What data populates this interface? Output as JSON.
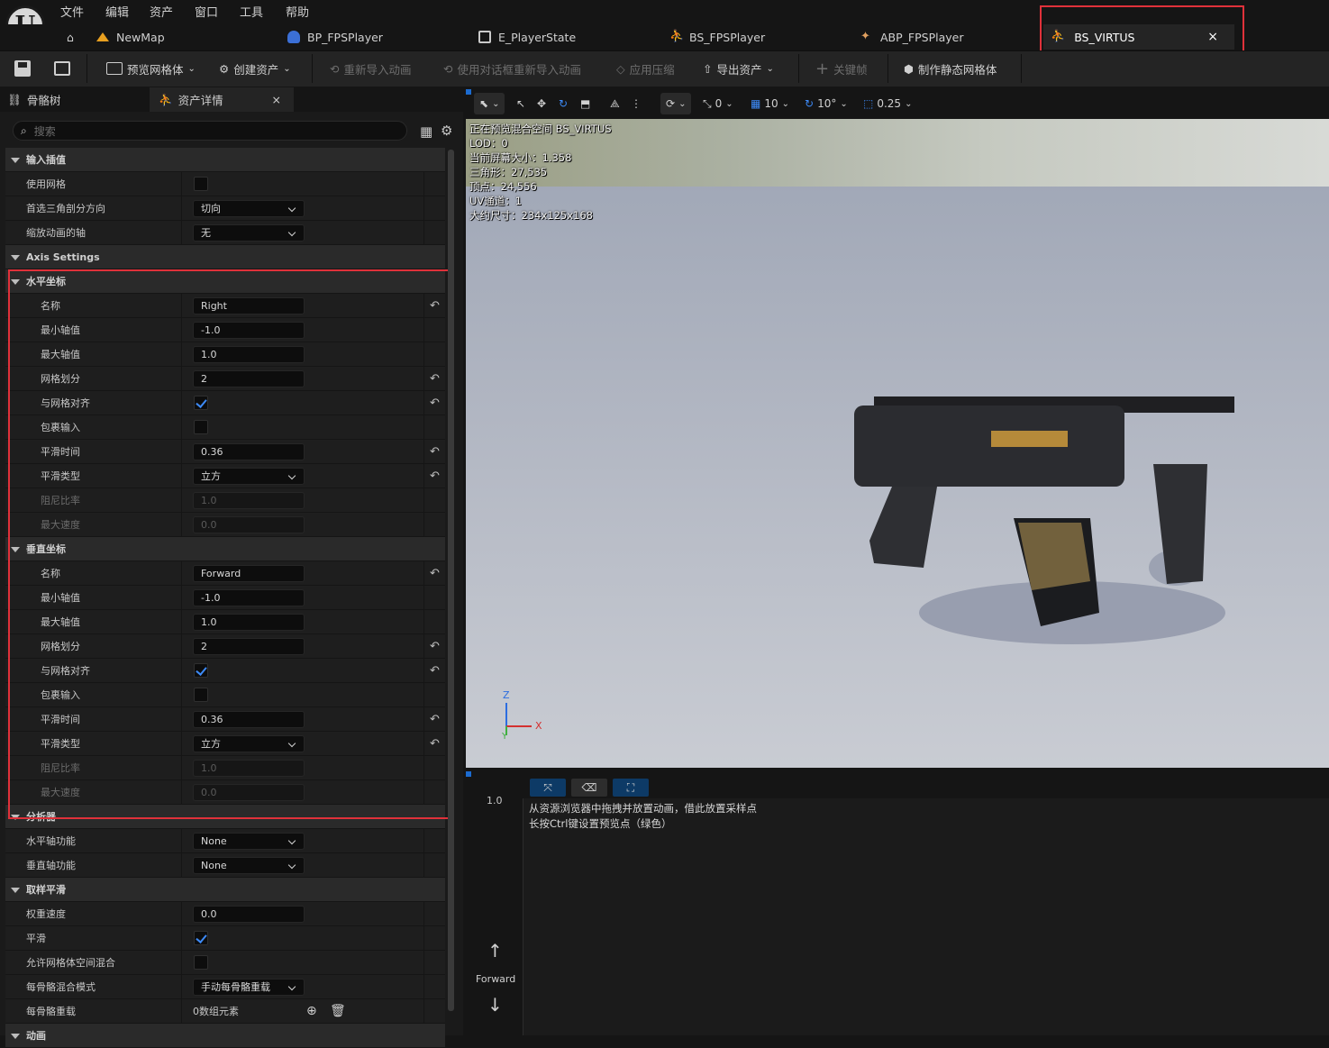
{
  "menu": [
    "文件",
    "编辑",
    "资产",
    "窗口",
    "工具",
    "帮助"
  ],
  "doc_tabs": [
    {
      "label": "NewMap",
      "icon": "map-icon"
    },
    {
      "label": "BP_FPSPlayer",
      "icon": "blueprint-icon"
    },
    {
      "label": "E_PlayerState",
      "icon": "enum-icon"
    },
    {
      "label": "BS_FPSPlayer",
      "icon": "blendspace-icon"
    },
    {
      "label": "ABP_FPSPlayer",
      "icon": "anim-blueprint-icon"
    }
  ],
  "active_tab": {
    "label": "BS_VIRTUS",
    "close": "×"
  },
  "toolbar": {
    "preview_mesh": "预览网格体",
    "create_asset": "创建资产",
    "reimport": "重新导入动画",
    "reimport_dialog": "使用对话框重新导入动画",
    "apply_compression": "应用压缩",
    "export_asset": "导出资产",
    "keyframe": "关键帧",
    "make_static_mesh": "制作静态网格体"
  },
  "left_tabs": {
    "skeleton_tree": "骨骼树",
    "asset_details": "资产详情",
    "close": "×"
  },
  "search_placeholder": "搜索",
  "props": {
    "input_interp": "输入插值",
    "use_grid": "使用网格",
    "pref_tri_dir": "首选三角剖分方向",
    "pref_tri_dir_val": "切向",
    "scale_anim_axis": "缩放动画的轴",
    "scale_anim_axis_val": "无",
    "axis_settings": "Axis Settings",
    "horizontal": "水平坐标",
    "vertical": "垂直坐标",
    "name": "名称",
    "min": "最小轴值",
    "max": "最大轴值",
    "grid_div": "网格划分",
    "snap_grid": "与网格对齐",
    "wrap_input": "包裹输入",
    "smooth_time": "平滑时间",
    "smooth_type": "平滑类型",
    "damping": "阻尼比率",
    "max_speed": "最大速度",
    "h_name": "Right",
    "h_min": "-1.0",
    "h_max": "1.0",
    "h_grid": "2",
    "h_smooth": "0.36",
    "h_smooth_type": "立方",
    "h_damp": "1.0",
    "h_speed": "0.0",
    "v_name": "Forward",
    "v_min": "-1.0",
    "v_max": "1.0",
    "v_grid": "2",
    "v_smooth": "0.36",
    "v_smooth_type": "立方",
    "v_damp": "1.0",
    "v_speed": "0.0",
    "analyzer": "分析器",
    "h_func": "水平轴功能",
    "h_func_val": "None",
    "v_func": "垂直轴功能",
    "v_func_val": "None",
    "sample_smoothing": "取样平滑",
    "weight_speed": "权重速度",
    "weight_speed_val": "0.0",
    "smoothing": "平滑",
    "allow_mesh_blend": "允许网格体空间混合",
    "per_bone_mode": "每骨骼混合模式",
    "per_bone_mode_val": "手动每骨骼重载",
    "per_bone_override": "每骨骼重载",
    "per_bone_override_val": "0数组元素",
    "animation": "动画"
  },
  "viewport": {
    "toolbar": {
      "snap_angle": "0",
      "grid": "10",
      "rot": "10°",
      "scale": "0.25"
    },
    "hud": [
      "正在预览混合空间 BS_VIRTUS",
      "LOD：0",
      "当前屏幕大小：1.358",
      "三角形：27,535",
      "顶点：24,556",
      "UV通道：1",
      "大约尺寸：234x125x168"
    ],
    "axis": {
      "z": "Z",
      "x": "X",
      "y": "Y"
    }
  },
  "blend": {
    "y_value": "1.0",
    "hint1": "从资源浏览器中拖拽并放置动画，借此放置采样点",
    "hint2": "长按Ctrl键设置预览点（绿色）",
    "axis_label": "Forward"
  },
  "colors": {
    "highlight": "#e0313a",
    "checkbox": "#3d8af7"
  }
}
